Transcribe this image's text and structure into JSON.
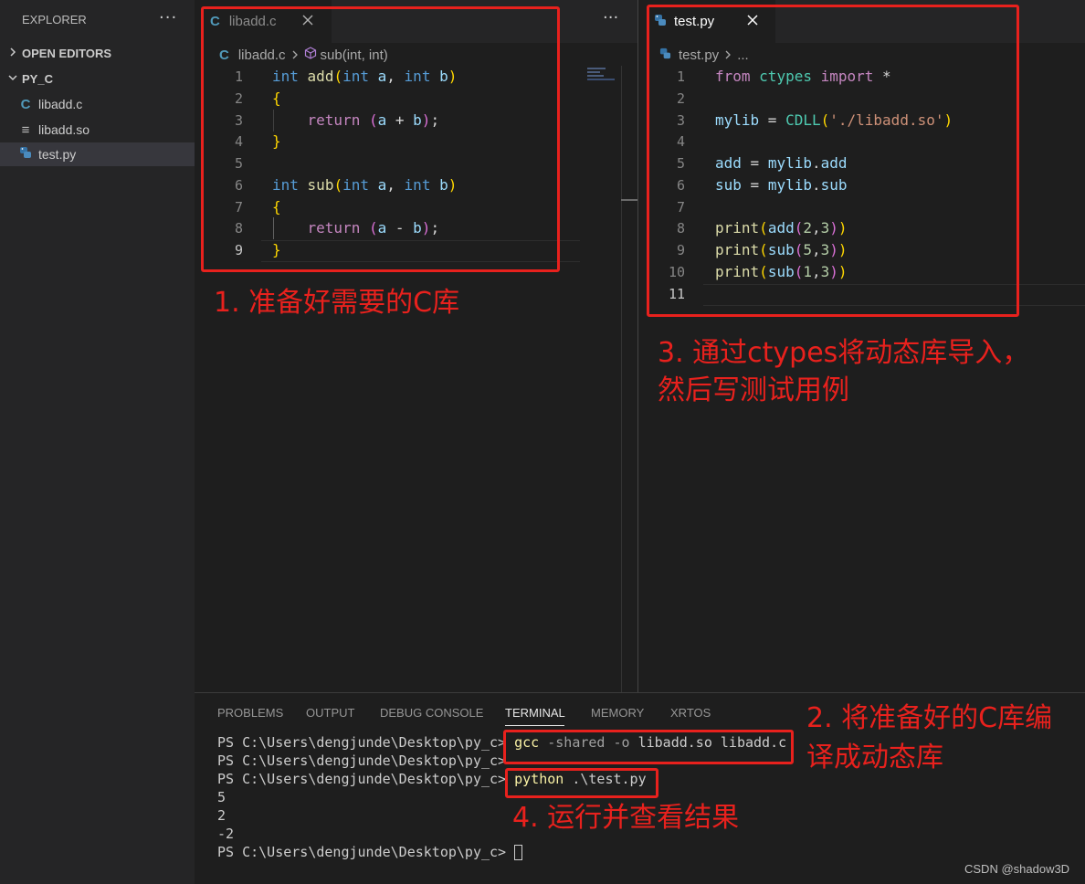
{
  "explorer": {
    "title": "EXPLORER",
    "more": "···",
    "open_editors": "OPEN EDITORS",
    "folder": "PY_C",
    "files": [
      {
        "name": "libadd.c",
        "icon": "C"
      },
      {
        "name": "libadd.so",
        "icon": "≡"
      },
      {
        "name": "test.py",
        "icon": "python"
      }
    ]
  },
  "editor1": {
    "tab_label": "libadd.c",
    "tab_icon": "C",
    "more": "···",
    "breadcrumb_file": "libadd.c",
    "breadcrumb_symbol": "sub(int, int)",
    "line_numbers": [
      "1",
      "2",
      "3",
      "4",
      "5",
      "6",
      "7",
      "8",
      "9"
    ]
  },
  "editor2": {
    "tab_label": "test.py",
    "breadcrumb_file": "test.py",
    "breadcrumb_more": "...",
    "line_numbers": [
      "1",
      "2",
      "3",
      "4",
      "5",
      "6",
      "7",
      "8",
      "9",
      "10",
      "11"
    ]
  },
  "panel": {
    "tabs": [
      "PROBLEMS",
      "OUTPUT",
      "DEBUG CONSOLE",
      "TERMINAL",
      "MEMORY",
      "XRTOS"
    ],
    "active_tab": "TERMINAL",
    "prompt": "PS C:\\Users\\dengjunde\\Desktop\\py_c>",
    "cmd1_gcc": "gcc",
    "cmd1_rest": "-shared -o",
    "cmd1_files": "libadd.so libadd.c",
    "cmd3_python": "python",
    "cmd3_rest": ".\\test.py",
    "outputs": [
      "5",
      "2",
      "-2"
    ]
  },
  "annotations": {
    "note1": "1. 准备好需要的C库",
    "note2_line1": "2. 将准备好的C库编",
    "note2_line2": "译成动态库",
    "note3_line1": "3. 通过ctypes将动态库导入，",
    "note3_line2": "然后写测试用例",
    "note4": "4. 运行并查看结果",
    "color": "#e8211d"
  },
  "watermark": "CSDN @shadow3D"
}
